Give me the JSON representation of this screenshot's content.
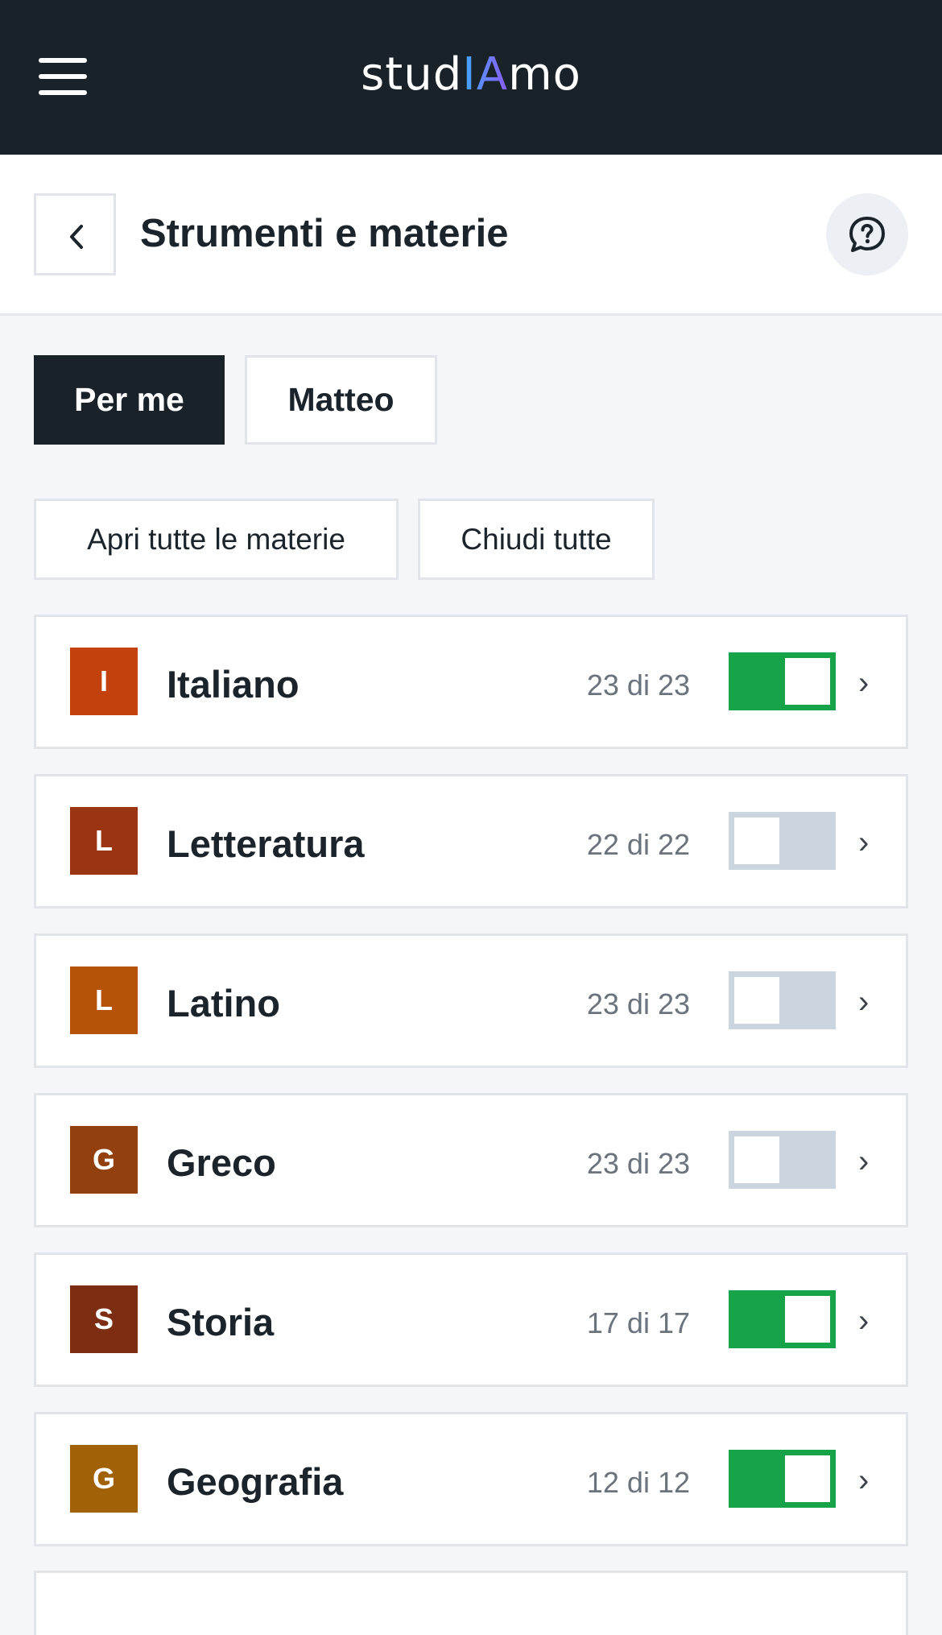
{
  "app": {
    "logo_prefix": "stud",
    "logo_highlight": "IA",
    "logo_suffix": "mo"
  },
  "header": {
    "title": "Strumenti e materie"
  },
  "tabs": [
    {
      "label": "Per me",
      "active": true
    },
    {
      "label": "Matteo",
      "active": false
    }
  ],
  "actions": {
    "open_all": "Apri tutte le materie",
    "close_all": "Chiudi tutte"
  },
  "subjects": [
    {
      "initial": "I",
      "name": "Italiano",
      "count": "23 di 23",
      "enabled": true,
      "color": "#c2410c"
    },
    {
      "initial": "L",
      "name": "Letteratura",
      "count": "22 di 22",
      "enabled": false,
      "color": "#9a3412"
    },
    {
      "initial": "L",
      "name": "Latino",
      "count": "23 di 23",
      "enabled": false,
      "color": "#b45309"
    },
    {
      "initial": "G",
      "name": "Greco",
      "count": "23 di 23",
      "enabled": false,
      "color": "#92400e"
    },
    {
      "initial": "S",
      "name": "Storia",
      "count": "17 di 17",
      "enabled": true,
      "color": "#7c2d12"
    },
    {
      "initial": "G",
      "name": "Geografia",
      "count": "12 di 12",
      "enabled": true,
      "color": "#a16207"
    }
  ],
  "icons": {
    "menu": "hamburger-icon",
    "back": "chevron-left-icon",
    "help": "question-bubble-icon",
    "row_arrow": "chevron-right-icon"
  },
  "colors": {
    "topbar": "#1a2229",
    "toggle_on": "#16a34a",
    "toggle_off": "#cbd5e0"
  }
}
